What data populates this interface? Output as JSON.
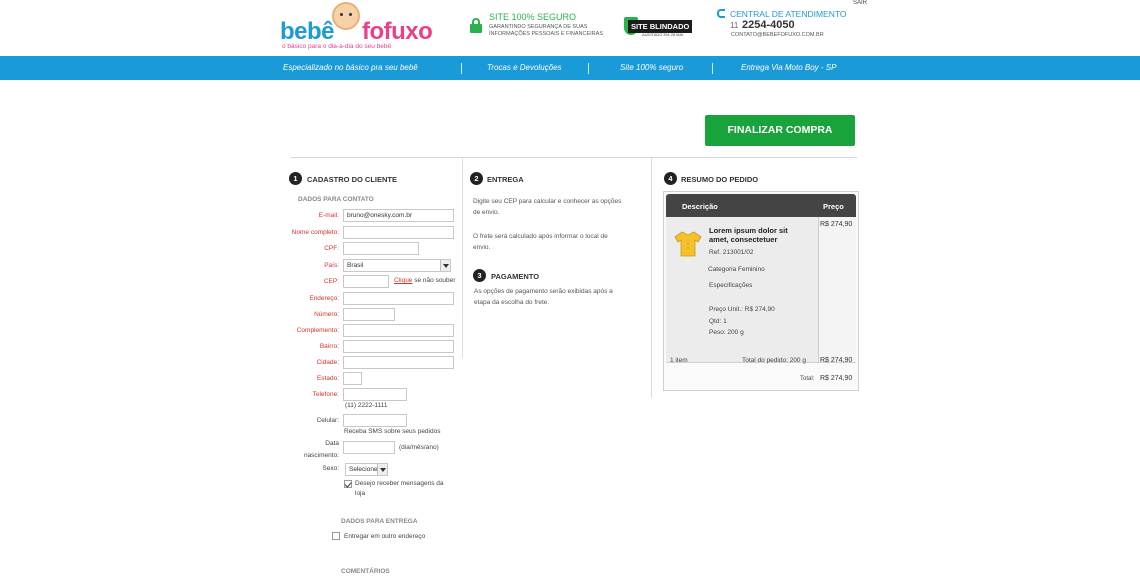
{
  "header": {
    "logo": {
      "word1": "bebê",
      "word2": "fofuxo",
      "tagline": "o básico para o dia-a-dia do seu bebê"
    },
    "secure": {
      "title": "SITE 100% SEGURO",
      "subtitle": "GARANTINDO SEGURANÇA DE SUAS INFORMAÇÕES PESSOAIS E FINANCEIRAS"
    },
    "blindado": {
      "title": "SITE BLINDADO",
      "subtitle": "AUDITADO EM 26 MAI"
    },
    "central": {
      "title": "CENTRAL DE ATENDIMENTO",
      "ddd": "11",
      "phone": "2254-4050",
      "email": "CONTATO@BEBEFOFUXO.COM.BR"
    },
    "logout": "SAIR"
  },
  "nav": [
    "Especializado no básico pra seu bebê",
    "Trocas e Devoluções",
    "Site 100% seguro",
    "Entrega Via Moto Boy - SP"
  ],
  "finalize_label": "FINALIZAR COMPRA",
  "cadastro": {
    "step": "1",
    "title": "CADASTRO DO CLIENTE",
    "section_contact": "DADOS PARA CONTATO",
    "labels": {
      "email": "E-mail:",
      "nome": "Nome completo:",
      "cpf": "CPF:",
      "pais": "País:",
      "cep": "CEP:",
      "endereco": "Endereço:",
      "numero": "Número:",
      "complemento": "Complemento:",
      "bairro": "Bairro:",
      "cidade": "Cidade:",
      "estado": "Estado:",
      "telefone": "Telefone:",
      "celular": "Celular:",
      "data1": "Data",
      "data2": "nascimento:",
      "sexo": "Sexo:"
    },
    "values": {
      "email": "bruno@onesky.com.br",
      "pais": "Brasil",
      "sexo": "Selecione"
    },
    "hints": {
      "cep_link": "Clique",
      "cep_rest": " se não souber",
      "telefone": "(11) 2222-1111",
      "celular": "Receba SMS sobre seus pedidos",
      "data": "(dia/mês/ano)",
      "newsletter1": "Desejo receber mensagens da",
      "newsletter2": "loja"
    },
    "section_delivery": "DADOS PARA ENTREGA",
    "other_address": "Entregar em outro endereço",
    "section_comments": "COMENTÁRIOS"
  },
  "entrega": {
    "step": "2",
    "title": "ENTREGA",
    "text1a": "Digite seu CEP para calcular e conhecer as opções",
    "text1b": "de envio.",
    "text2a": "O frete será calculado após informar o local de",
    "text2b": "envio."
  },
  "pagamento": {
    "step": "3",
    "title": "PAGAMENTO",
    "text1": "As opções de pagamento serão exibidas após a",
    "text2": "etapa da escolha do frete."
  },
  "resumo": {
    "step": "4",
    "title": "RESUMO DO PEDIDO",
    "col_desc": "Descrição",
    "col_price": "Preço",
    "product": {
      "name": "Lorem ipsum dolor sit amet, consectetuer",
      "ref": "Ref. 213001/02",
      "category": "Categoria Feminino",
      "specs": "Especificações",
      "unit_price": "Preço Unit.: R$ 274,90",
      "qty": "Qtd: 1",
      "weight": "Peso: 200 g",
      "price": "R$ 274,90"
    },
    "items_count": "1 item",
    "total_order": "Total do pedido: 200 g",
    "total_order_price": "R$ 274,90",
    "total_label": "Total:",
    "total_price": "R$ 274,90"
  },
  "colors": {
    "brand_blue": "#1b9ad8",
    "brand_pink": "#e8418a",
    "cta_green": "#18a33b",
    "required_red": "#d6332f"
  }
}
